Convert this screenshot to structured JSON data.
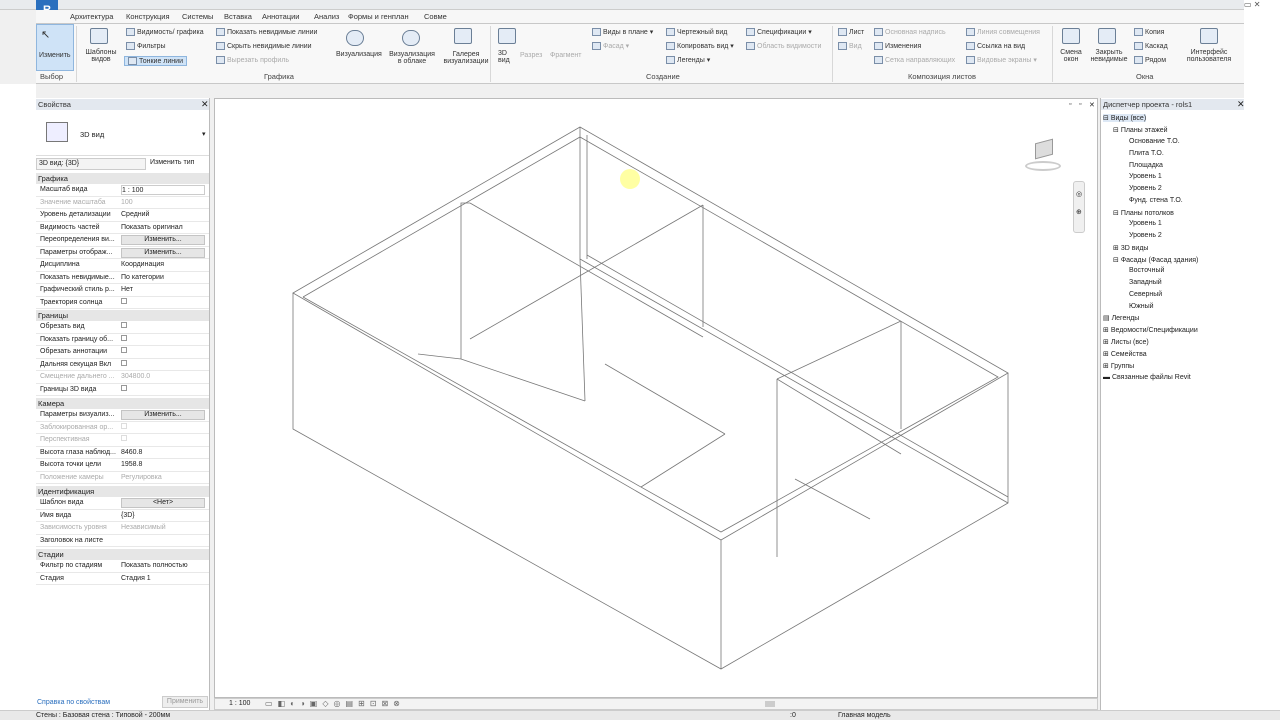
{
  "app": {
    "logo": "R"
  },
  "tabs": [
    "Архитектура",
    "Конструкция",
    "Системы",
    "Вставка",
    "Аннотации",
    "Анализ",
    "Формы и генплан",
    "Совме"
  ],
  "ribbon": {
    "modify": "Изменить",
    "templates": "Шаблоны видов",
    "visibility": "Видимость/ графика",
    "filters": "Фильтры",
    "thin_lines": "Тонкие линии",
    "show_hidden": "Показать невидимые линии",
    "remove_hidden": "Скрыть невидимые линии",
    "cut_profile": "Вырезать профиль",
    "render": "Визуализация",
    "render_cloud": "Визуализация в облаке",
    "render_gallery": "Галерея визуализации",
    "view3d": "3D вид",
    "section": "Разрез",
    "callout": "Фрагмент",
    "plan_views": "Виды в плане",
    "elevation": "Фасад",
    "drafting": "Чертежный вид",
    "duplicate": "Копировать вид",
    "legends": "Легенды",
    "schedules": "Спецификации",
    "scope_box": "Область видимости",
    "sheet": "Лист",
    "view": "Вид",
    "title_block": "Основная надпись",
    "revisions": "Изменения",
    "guide_grid": "Сетка направляющих",
    "matchline": "Линия совмещения",
    "view_ref": "Ссылка на вид",
    "viewports": "Видовые экраны",
    "switch_windows": "Смена окон",
    "close_hidden": "Закрыть невидимые",
    "replicate": "Копия",
    "cascade": "Каскад",
    "tile": "Рядом",
    "ui": "Интерфейс пользователя",
    "panel_select": "Выбор",
    "panel_graphics": "Графика",
    "panel_create": "Создание",
    "panel_sheet": "Композиция листов",
    "panel_windows": "Окна"
  },
  "props": {
    "title": "Свойства",
    "type_name": "3D вид",
    "selector": "3D вид: {3D}",
    "edit_type": "Изменить тип",
    "help": "Справка по свойствам",
    "apply": "Применить",
    "sections": {
      "graphics": "Графика",
      "extents": "Границы",
      "camera": "Камера",
      "identity": "Идентификация",
      "phasing": "Стадии"
    },
    "rows": {
      "scale_k": "Масштаб вида",
      "scale_v": "1 : 100",
      "scaleval_k": "Значение масштаба",
      "scaleval_v": "100",
      "detail_k": "Уровень детализации",
      "detail_v": "Средний",
      "parts_k": "Видимость частей",
      "parts_v": "Показать оригинал",
      "overrides_k": "Переопределения ви...",
      "overrides_v": "Изменить...",
      "display_k": "Параметры отображ...",
      "display_v": "Изменить...",
      "disc_k": "Дисциплина",
      "disc_v": "Координация",
      "hidden_k": "Показать невидимые...",
      "hidden_v": "По категории",
      "gstyle_k": "Графический стиль р...",
      "gstyle_v": "Нет",
      "sun_k": "Траектория солнца",
      "crop_k": "Обрезать вид",
      "cropshow_k": "Показать границу об...",
      "annocrop_k": "Обрезать аннотации",
      "farclip_k": "Дальняя секущая Вкл",
      "faroffset_k": "Смещение дальнего ...",
      "faroffset_v": "304800.0",
      "box3d_k": "Границы 3D вида",
      "rendset_k": "Параметры визуализ...",
      "rendset_v": "Изменить...",
      "locked_k": "Заблокированная ор...",
      "persp_k": "Перспективная",
      "eye_k": "Высота глаза наблюд...",
      "eye_v": "8460.8",
      "target_k": "Высота точки цели",
      "target_v": "1958.8",
      "campos_k": "Положение камеры",
      "campos_v": "Регулировка",
      "tmpl_k": "Шаблон вида",
      "tmpl_v": "<Нет>",
      "name_k": "Имя вида",
      "name_v": "{3D}",
      "dep_k": "Зависимость уровня",
      "dep_v": "Независимый",
      "titleonsheet_k": "Заголовок на листе",
      "phasefilter_k": "Фильтр по стадиям",
      "phasefilter_v": "Показать полностью",
      "phase_k": "Стадия",
      "phase_v": "Стадия 1"
    }
  },
  "browser": {
    "title": "Диспетчер проекта - rols1",
    "views_all": "Виды (все)",
    "floor_plans": "Планы этажей",
    "fp1": "Основание Т.О.",
    "fp2": "Плита Т.О.",
    "fp3": "Площадка",
    "fp4": "Уровень 1",
    "fp5": "Уровень 2",
    "fp6": "Фунд. стена Т.О.",
    "ceiling_plans": "Планы потолков",
    "cp1": "Уровень 1",
    "cp2": "Уровень 2",
    "views3d": "3D виды",
    "elevations": "Фасады (Фасад здания)",
    "el1": "Восточный",
    "el2": "Западный",
    "el3": "Северный",
    "el4": "Южный",
    "legends": "Легенды",
    "schedules": "Ведомости/Спецификации",
    "sheets": "Листы (все)",
    "families": "Семейства",
    "groups": "Группы",
    "links": "Связанные файлы Revit"
  },
  "viewbar": {
    "scale": "1 : 100"
  },
  "status": {
    "text": "Стены : Базовая стена : Типовой - 200мм",
    "model": "Главная модель",
    "zero": ":0"
  }
}
